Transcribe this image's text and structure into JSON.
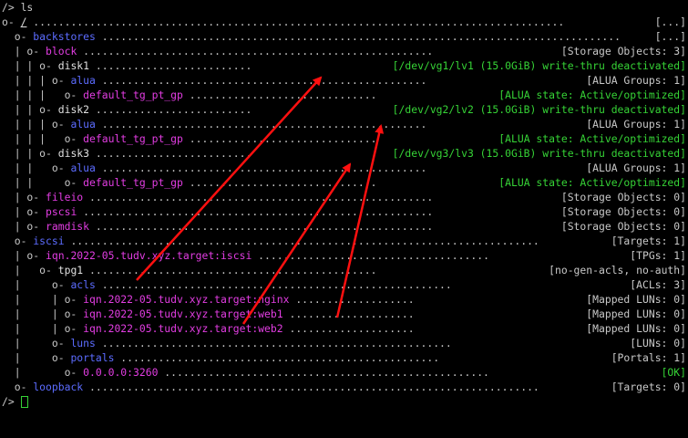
{
  "prompt": "/> ls",
  "end_prompt": "/>",
  "lines": [
    {
      "prefix": "o- ",
      "name": "/",
      "color": "wht",
      "underline": true,
      "dots": " .....................................................................................",
      "status": "[...]",
      "status_color": "tree"
    },
    {
      "prefix": "  o- ",
      "name": "backstores",
      "color": "blue",
      "dots": " ...................................................................................",
      "status": "[...]",
      "status_color": "tree"
    },
    {
      "prefix": "  | o- ",
      "name": "block",
      "color": "mag",
      "dots": " ........................................................",
      "status": "[Storage Objects: 3]",
      "status_color": "tree"
    },
    {
      "prefix": "  | | o- ",
      "name": "disk1",
      "color": "wht",
      "dots": " .........................",
      "status": "[/dev/vg1/lv1 (15.0GiB) write-thru deactivated]",
      "status_color": "grn"
    },
    {
      "prefix": "  | | | o- ",
      "name": "alua",
      "color": "blue",
      "dots": " ....................................................",
      "status": "[ALUA Groups: 1]",
      "status_color": "tree"
    },
    {
      "prefix": "  | | |   o- ",
      "name": "default_tg_pt_gp",
      "color": "mag",
      "dots": " ..............................",
      "status": "[ALUA state: Active/optimized]",
      "status_color": "grn"
    },
    {
      "prefix": "  | | o- ",
      "name": "disk2",
      "color": "wht",
      "dots": " .........................",
      "status": "[/dev/vg2/lv2 (15.0GiB) write-thru deactivated]",
      "status_color": "grn"
    },
    {
      "prefix": "  | | | o- ",
      "name": "alua",
      "color": "blue",
      "dots": " ....................................................",
      "status": "[ALUA Groups: 1]",
      "status_color": "tree"
    },
    {
      "prefix": "  | | |   o- ",
      "name": "default_tg_pt_gp",
      "color": "mag",
      "dots": " ..............................",
      "status": "[ALUA state: Active/optimized]",
      "status_color": "grn"
    },
    {
      "prefix": "  | | o- ",
      "name": "disk3",
      "color": "wht",
      "dots": " .........................",
      "status": "[/dev/vg3/lv3 (15.0GiB) write-thru deactivated]",
      "status_color": "grn"
    },
    {
      "prefix": "  | |   o- ",
      "name": "alua",
      "color": "blue",
      "dots": " ....................................................",
      "status": "[ALUA Groups: 1]",
      "status_color": "tree"
    },
    {
      "prefix": "  | |     o- ",
      "name": "default_tg_pt_gp",
      "color": "mag",
      "dots": " ..............................",
      "status": "[ALUA state: Active/optimized]",
      "status_color": "grn"
    },
    {
      "prefix": "  | o- ",
      "name": "fileio",
      "color": "mag",
      "dots": " .......................................................",
      "status": "[Storage Objects: 0]",
      "status_color": "tree"
    },
    {
      "prefix": "  | o- ",
      "name": "pscsi",
      "color": "mag",
      "dots": " ........................................................",
      "status": "[Storage Objects: 0]",
      "status_color": "tree"
    },
    {
      "prefix": "  | o- ",
      "name": "ramdisk",
      "color": "mag",
      "dots": " ......................................................",
      "status": "[Storage Objects: 0]",
      "status_color": "tree"
    },
    {
      "prefix": "  o- ",
      "name": "iscsi",
      "color": "blue",
      "dots": " ...........................................................................",
      "status": "[Targets: 1]",
      "status_color": "tree"
    },
    {
      "prefix": "  | o- ",
      "name": "iqn.2022-05.tudv.xyz.target:iscsi",
      "color": "mag",
      "dots": " .....................................",
      "status": "[TPGs: 1]",
      "status_color": "tree"
    },
    {
      "prefix": "  |   o- ",
      "name": "tpg1",
      "color": "wht",
      "dots": " ..............................................",
      "status": "[no-gen-acls, no-auth]",
      "status_color": "tree"
    },
    {
      "prefix": "  |     o- ",
      "name": "acls",
      "color": "blue",
      "dots": " ........................................................",
      "status": "[ACLs: 3]",
      "status_color": "tree"
    },
    {
      "prefix": "  |     | o- ",
      "name": "iqn.2022-05.tudv.xyz.target:nginx",
      "color": "mag",
      "dots": " ...................",
      "status": "[Mapped LUNs: 0]",
      "status_color": "tree"
    },
    {
      "prefix": "  |     | o- ",
      "name": "iqn.2022-05.tudv.xyz.target:web1",
      "color": "mag",
      "dots": " ....................",
      "status": "[Mapped LUNs: 0]",
      "status_color": "tree"
    },
    {
      "prefix": "  |     | o- ",
      "name": "iqn.2022-05.tudv.xyz.target:web2",
      "color": "mag",
      "dots": " ....................",
      "status": "[Mapped LUNs: 0]",
      "status_color": "tree"
    },
    {
      "prefix": "  |     o- ",
      "name": "luns",
      "color": "blue",
      "dots": " ........................................................",
      "status": "[LUNs: 0]",
      "status_color": "tree"
    },
    {
      "prefix": "  |     o- ",
      "name": "portals",
      "color": "blue",
      "dots": " ...................................................",
      "status": "[Portals: 1]",
      "status_color": "tree"
    },
    {
      "prefix": "  |       o- ",
      "name": "0.0.0.0:3260",
      "color": "mag",
      "dots": " ....................................................",
      "status": "[OK]",
      "status_color": "grn"
    },
    {
      "prefix": "  o- ",
      "name": "loopback",
      "color": "blue",
      "dots": " ........................................................................",
      "status": "[Targets: 0]",
      "status_color": "tree"
    }
  ],
  "colors": {
    "blue": "#5c6cff",
    "magenta": "#e23de2",
    "green": "#36d336",
    "arrow": "#ff1010"
  }
}
